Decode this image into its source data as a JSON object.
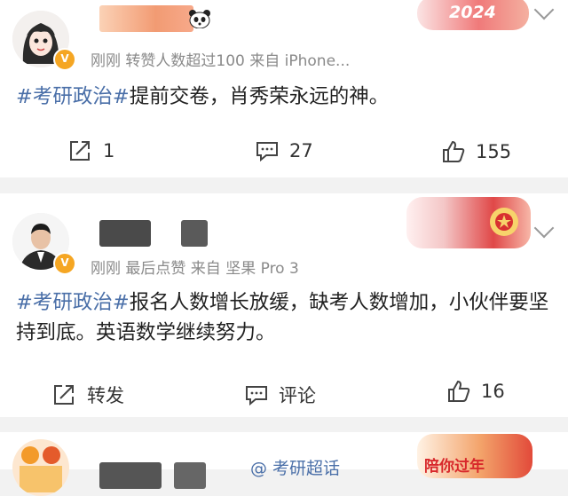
{
  "colors": {
    "tag": "#4a6fa8",
    "meta": "#8a8a8a",
    "page_bg": "#f2f2f2",
    "verified": "#f5a623"
  },
  "posts": [
    {
      "meta": "刚刚 转赞人数超过100 来自 iPhone...",
      "hashtag": "#考研政治#",
      "text": "提前交卷，肖秀荣永远的神。",
      "actions": {
        "share": "1",
        "comment": "27",
        "like": "155"
      },
      "deco_text": "2024"
    },
    {
      "meta": "刚刚 最后点赞 来自 坚果 Pro 3",
      "hashtag": "#考研政治#",
      "text": "报名人数增长放缓，缺考人数增加，小伙伴要坚持到底。英语数学继续努力。",
      "actions": {
        "share": "转发",
        "comment": "评论",
        "like": "16"
      }
    },
    {
      "meta": "@ 考研超话",
      "deco_text": "陪你过年"
    }
  ],
  "icons": [
    "share-icon",
    "comment-icon",
    "like-icon",
    "chevron-down-icon",
    "verified-badge-icon"
  ]
}
